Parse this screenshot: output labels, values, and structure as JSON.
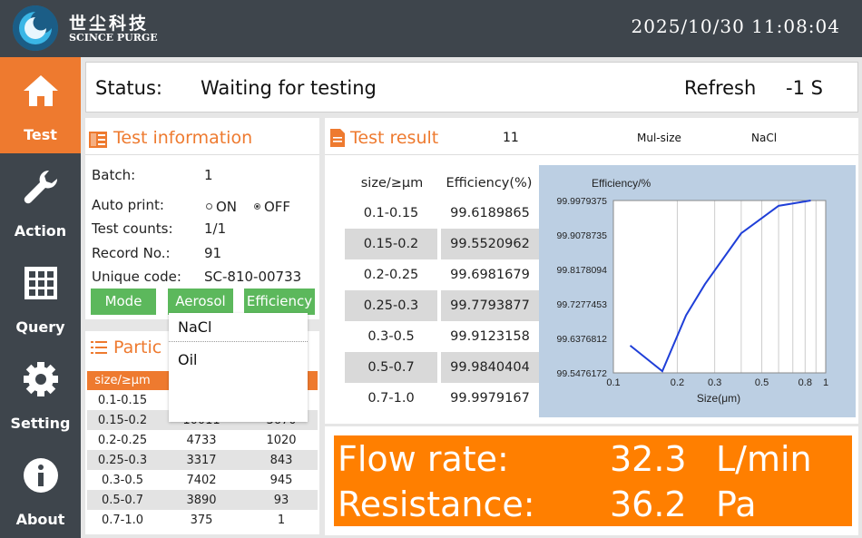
{
  "header": {
    "logo_cn": "世尘科技",
    "logo_en": "SCINCE PURGE",
    "datetime": "2025/10/30  11:08:04",
    "background_color": "#3e454c"
  },
  "sidebar": {
    "accent_color": "#ee7a2f",
    "items": [
      {
        "label": "Test",
        "icon": "home-icon",
        "active": true
      },
      {
        "label": "Action",
        "icon": "wrench-icon",
        "active": false
      },
      {
        "label": "Query",
        "icon": "grid-icon",
        "active": false
      },
      {
        "label": "Setting",
        "icon": "gear-icon",
        "active": false
      },
      {
        "label": "About",
        "icon": "info-icon",
        "active": false
      }
    ]
  },
  "status": {
    "label": "Status:",
    "value": "Waiting for testing",
    "refresh_label": "Refresh",
    "refresh_value": "-1 S"
  },
  "test_info": {
    "title": "Test information",
    "batch_label": "Batch:",
    "batch_value": "1",
    "auto_print_label": "Auto print:",
    "auto_print_on": "ON",
    "auto_print_off": "OFF",
    "auto_print_selected": "OFF",
    "test_counts_label": "Test counts:",
    "test_counts_value": "1/1",
    "record_label": "Record No.:",
    "record_value": "91",
    "unique_label": "Unique code:",
    "unique_value": "SC-810-00733",
    "buttons": {
      "mode": "Mode",
      "aerosol": "Aerosol",
      "efficiency": "Efficiency"
    }
  },
  "aerosol_dropdown": {
    "options": [
      "NaCl",
      "Oil"
    ]
  },
  "particle": {
    "title_visible": "Partic",
    "headers": [
      "size/≥μm",
      "",
      ""
    ],
    "rows": [
      [
        "0.1-0.15",
        "",
        ""
      ],
      [
        "0.15-0.2",
        "10011",
        "3670"
      ],
      [
        "0.2-0.25",
        "4733",
        "1020"
      ],
      [
        "0.25-0.3",
        "3317",
        "843"
      ],
      [
        "0.3-0.5",
        "7402",
        "945"
      ],
      [
        "0.5-0.7",
        "3890",
        "93"
      ],
      [
        "0.7-1.0",
        "375",
        "1"
      ]
    ]
  },
  "result": {
    "title": "Test result",
    "count": "11",
    "mode": "Mul-size",
    "aerosol": "NaCl",
    "headers": [
      "size/≥μm",
      "Efficiency(%)"
    ],
    "rows": [
      [
        "0.1-0.15",
        "99.6189865"
      ],
      [
        "0.15-0.2",
        "99.5520962"
      ],
      [
        "0.2-0.25",
        "99.6981679"
      ],
      [
        "0.25-0.3",
        "99.7793877"
      ],
      [
        "0.3-0.5",
        "99.9123158"
      ],
      [
        "0.5-0.7",
        "99.9840404"
      ],
      [
        "0.7-1.0",
        "99.9979167"
      ]
    ]
  },
  "chart_data": {
    "type": "line",
    "title": "Efficiency/%",
    "xlabel": "Size(μm)",
    "ylabel": "",
    "x_ticks": [
      "0.1",
      "0.2",
      "0.3",
      "0.5",
      "0.8",
      "1"
    ],
    "y_ticks": [
      "99.9979375",
      "99.9078735",
      "99.8178094",
      "99.7277453",
      "99.6376812",
      "99.5476172"
    ],
    "ylim": [
      99.5476172,
      99.9979375
    ],
    "xlim": [
      0.1,
      1
    ],
    "series": [
      {
        "x": [
          0.12,
          0.17,
          0.22,
          0.27,
          0.4,
          0.6,
          0.85
        ],
        "values": [
          99.6189865,
          99.5520962,
          99.6981679,
          99.7793877,
          99.9123158,
          99.9840404,
          99.9979167
        ]
      }
    ],
    "line_color": "#1f3fd8",
    "background_color": "#bccfe3",
    "grid": true
  },
  "flow": {
    "flow_label": "Flow rate:",
    "flow_value": "32.3",
    "flow_unit": "L/min",
    "resistance_label": "Resistance:",
    "resistance_value": "36.2",
    "resistance_unit": "Pa",
    "background_color": "#ff7f00"
  }
}
